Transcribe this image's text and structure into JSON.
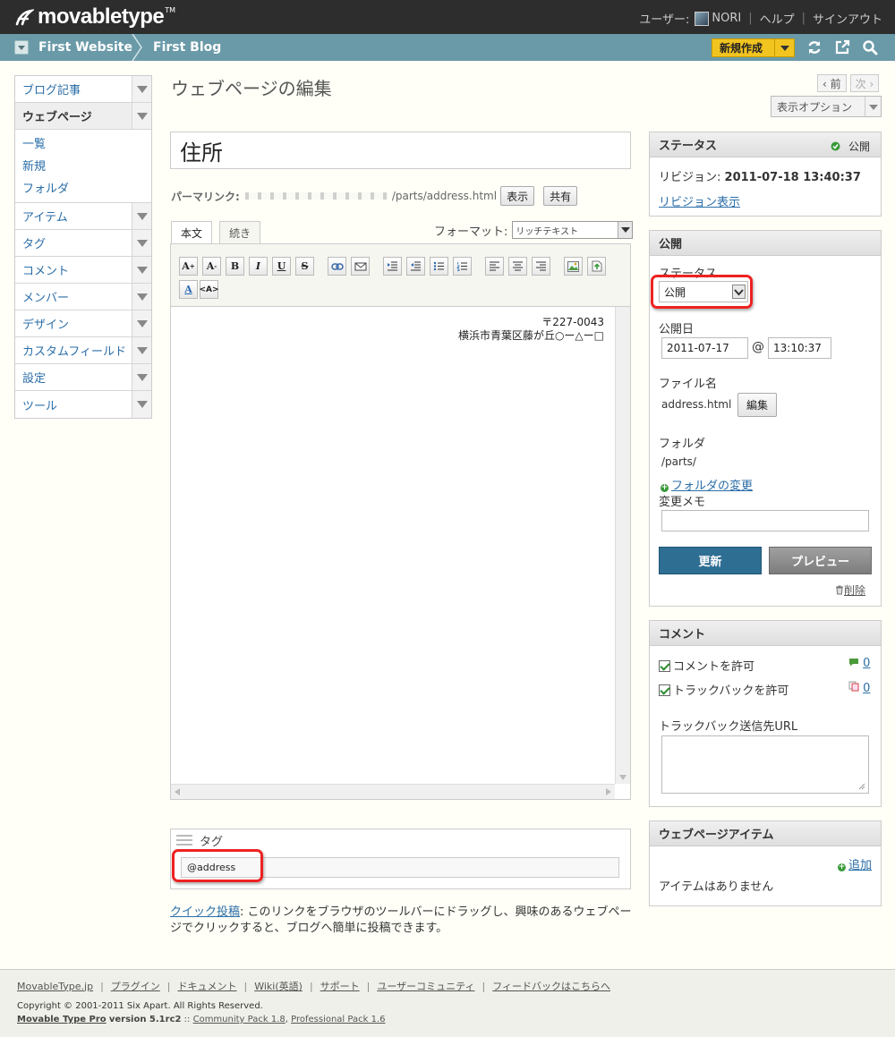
{
  "topbar": {
    "logo_text": "movabletype",
    "logo_tm": "TM",
    "user_label": "ユーザー:",
    "user_name": "NORI",
    "help": "ヘルプ",
    "signout": "サインアウト"
  },
  "scope": {
    "website": "First Website",
    "blog": "First Blog",
    "new_button": "新規作成"
  },
  "sidenav": {
    "items": [
      {
        "label": "ブログ記事"
      },
      {
        "label": "ウェブページ"
      },
      {
        "label": "アイテム"
      },
      {
        "label": "タグ"
      },
      {
        "label": "コメント"
      },
      {
        "label": "メンバー"
      },
      {
        "label": "デザイン"
      },
      {
        "label": "カスタムフィールド"
      },
      {
        "label": "設定"
      },
      {
        "label": "ツール"
      }
    ],
    "submenu": [
      "一覧",
      "新規",
      "フォルダ"
    ]
  },
  "main": {
    "page_title": "ウェブページの編集",
    "prev": "‹ 前",
    "next": "次 ›",
    "display_options": "表示オプション",
    "title_value": "住所",
    "permalink_label": "パーマリンク:",
    "permalink_path": "/parts/address.html",
    "view_button": "表示",
    "share_button": "共有",
    "tab_body": "本文",
    "tab_more": "続き",
    "format_label": "フォーマット:",
    "format_value": "リッチテキスト",
    "body_line1": "〒227-0043",
    "body_line2": "横浜市青葉区藤が丘○ー△ー□",
    "tags_label": "タグ",
    "tags_value": "@address",
    "quickpost_link": "クイック投稿",
    "quickpost_text": ": このリンクをブラウザのツールバーにドラッグし、興味のあるウェブページでクリックすると、ブログへ簡単に投稿できます。"
  },
  "status_widget": {
    "title": "ステータス",
    "status": "公開",
    "revision_label": "リビジョン:",
    "revision_value": "2011-07-18 13:40:37",
    "revision_link": "リビジョン表示"
  },
  "publish_widget": {
    "title": "公開",
    "status_label": "ステータス",
    "status_value": "公開",
    "date_label": "公開日",
    "date_value": "2011-07-17",
    "at": "@",
    "time_value": "13:10:37",
    "filename_label": "ファイル名",
    "filename_value": "address.html",
    "edit_button": "編集",
    "folder_label": "フォルダ",
    "folder_value": "/parts/",
    "folder_change": "フォルダの変更",
    "memo_label": "変更メモ",
    "update_button": "更新",
    "preview_button": "プレビュー",
    "delete_link": "削除"
  },
  "comment_widget": {
    "title": "コメント",
    "allow_comments": "コメントを許可",
    "comment_count": "0",
    "allow_trackbacks": "トラックバックを許可",
    "trackback_count": "0",
    "trackback_url_label": "トラックバック送信先URL"
  },
  "items_widget": {
    "title": "ウェブページアイテム",
    "add": "追加",
    "empty": "アイテムはありません"
  },
  "footer": {
    "links": [
      "MovableType.jp",
      "プラグイン",
      "ドキュメント",
      "Wiki(英語)",
      "サポート",
      "ユーザーコミュニティ",
      "フィードバックはこちらへ"
    ],
    "copyright": "Copyright © 2001-2011 Six Apart. All Rights Reserved.",
    "product": "Movable Type Pro",
    "version": "version 5.1rc2",
    "separator": "::",
    "community_pack": "Community Pack 1.8",
    "comma": ",",
    "professional_pack": "Professional Pack 1.6"
  },
  "colors": {
    "topbar": "#2d2d2d",
    "scopebar": "#6a9aa8",
    "new_button": "#f2c420",
    "update_button": "#2f6e93",
    "preview_button": "#8c8c8c",
    "highlight": "#e22222",
    "link": "#2b6ea8"
  }
}
